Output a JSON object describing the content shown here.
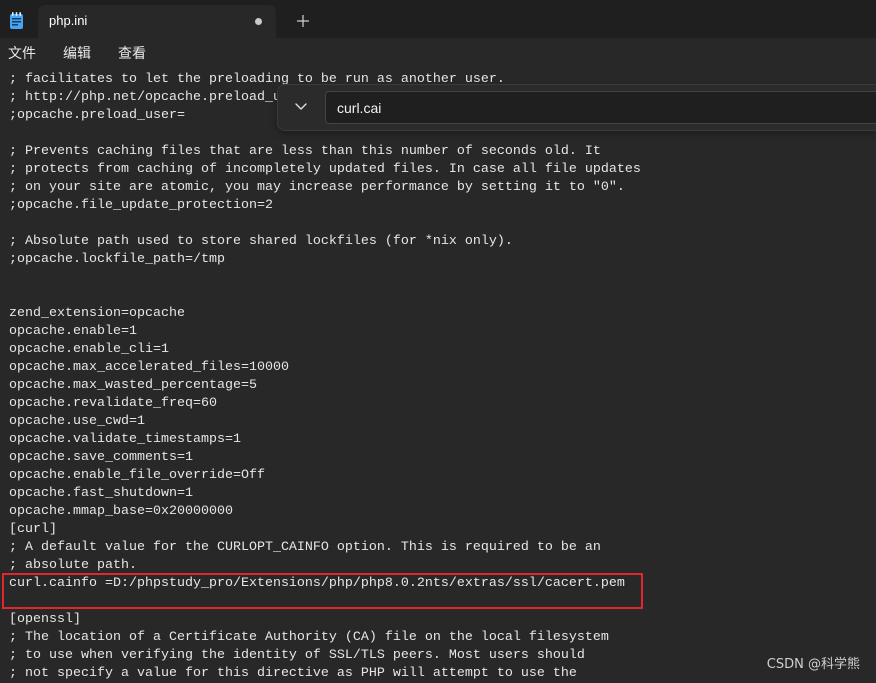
{
  "app": {
    "icon": "notepad-icon"
  },
  "tabs": [
    {
      "title": "php.ini",
      "status_icon": "unsaved-dot-icon"
    }
  ],
  "new_tab": {
    "icon": "plus-icon"
  },
  "menu": {
    "items": [
      "文件",
      "编辑",
      "查看"
    ]
  },
  "find": {
    "value": "curl.cai",
    "toggle_icon": "chevron-down-icon"
  },
  "editor": {
    "lines": [
      "; facilitates to let the preloading to be run as another user.",
      "; http://php.net/opcache.preload_u",
      ";opcache.preload_user=",
      "",
      "; Prevents caching files that are less than this number of seconds old. It",
      "; protects from caching of incompletely updated files. In case all file updates",
      "; on your site are atomic, you may increase performance by setting it to \"0\".",
      ";opcache.file_update_protection=2",
      "",
      "; Absolute path used to store shared lockfiles (for *nix only).",
      ";opcache.lockfile_path=/tmp",
      "",
      "",
      "zend_extension=opcache",
      "opcache.enable=1",
      "opcache.enable_cli=1",
      "opcache.max_accelerated_files=10000",
      "opcache.max_wasted_percentage=5",
      "opcache.revalidate_freq=60",
      "opcache.use_cwd=1",
      "opcache.validate_timestamps=1",
      "opcache.save_comments=1",
      "opcache.enable_file_override=Off",
      "opcache.fast_shutdown=1",
      "opcache.mmap_base=0x20000000",
      "[curl]",
      "; A default value for the CURLOPT_CAINFO option. This is required to be an",
      "; absolute path.",
      "curl.cainfo =D:/phpstudy_pro/Extensions/php/php8.0.2nts/extras/ssl/cacert.pem",
      "",
      "[openssl]",
      "; The location of a Certificate Authority (CA) file on the local filesystem",
      "; to use when verifying the identity of SSL/TLS peers. Most users should",
      "; not specify a value for this directive as PHP will attempt to use the"
    ]
  },
  "highlight": {
    "first_line": 28,
    "last_line": 29
  },
  "watermark": {
    "text": "CSDN @科学熊"
  },
  "colors": {
    "title_bar": "#1f1f1f",
    "editor_background": "#282828",
    "editor_text": "#e6e6e6",
    "find_panel": "#2b2b2b",
    "annotation": "#e3262c",
    "icon_blue": "#4aa3f0"
  }
}
